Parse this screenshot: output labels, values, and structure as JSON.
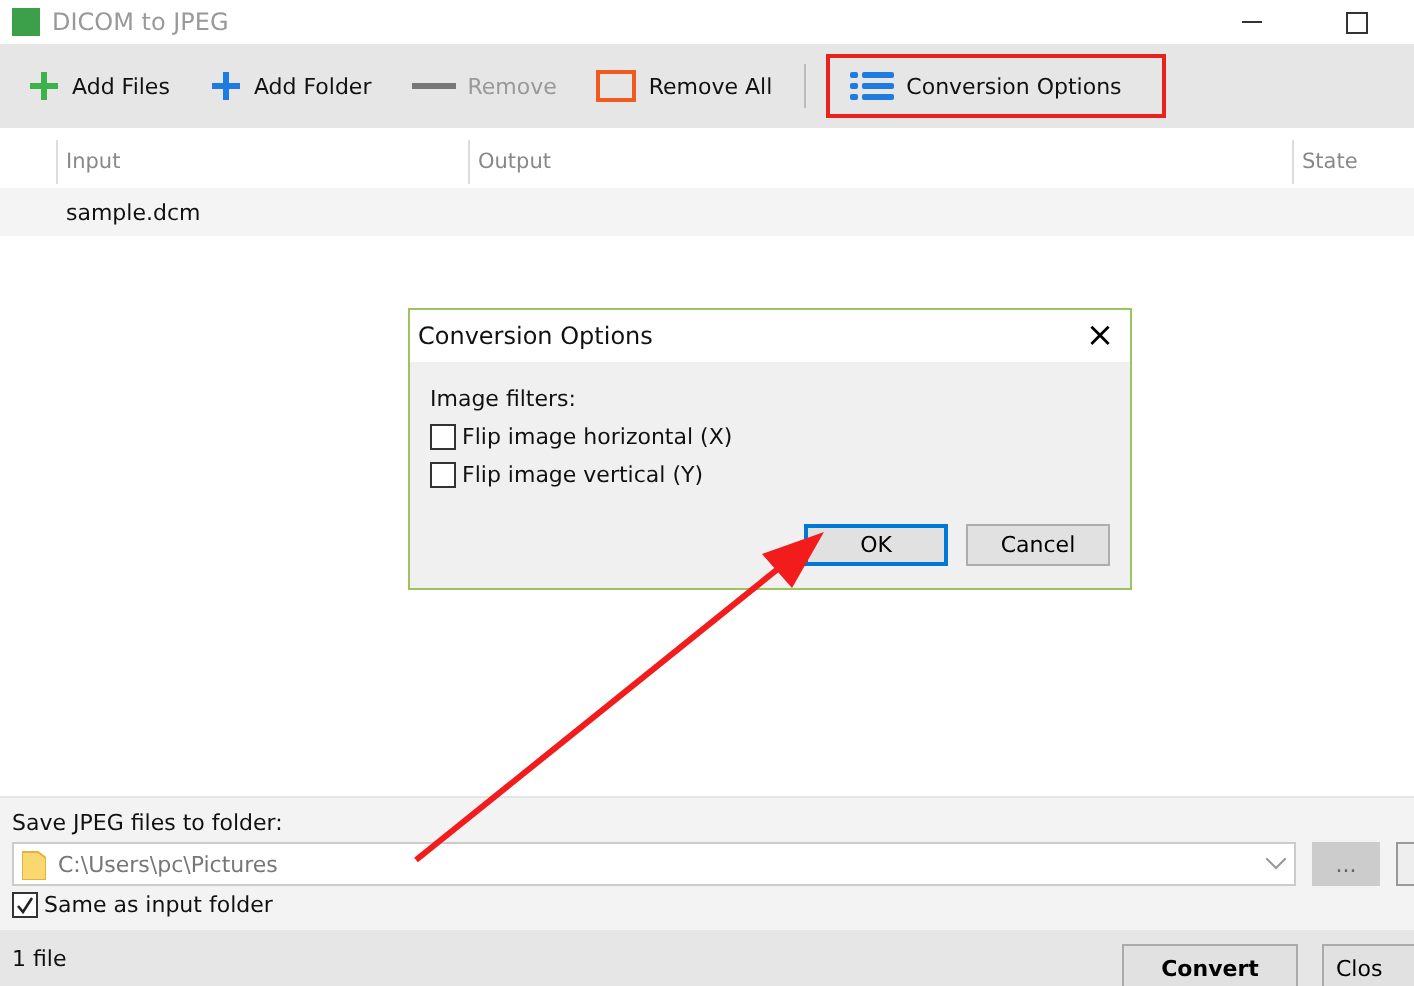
{
  "window": {
    "title": "DICOM to JPEG"
  },
  "toolbar": [
    {
      "label": "Add Files",
      "kind": "add",
      "disabled": false
    },
    {
      "label": "Add Folder",
      "kind": "folder",
      "disabled": false
    },
    {
      "label": "Remove",
      "kind": "remove",
      "disabled": true
    },
    {
      "label": "Remove All",
      "kind": "clear",
      "disabled": false
    },
    {
      "label": "Conversion Options",
      "kind": "options",
      "disabled": false,
      "highlighted": true
    }
  ],
  "table": {
    "columns": [
      "Input",
      "Output",
      "State"
    ],
    "rows": [
      {
        "input": "sample.dcm"
      }
    ]
  },
  "output": {
    "label": "Save JPEG files to folder:",
    "path": "C:\\Users\\pc\\Pictures",
    "browse": "...",
    "same_as_input": {
      "label": "Same as input folder",
      "checked": true
    }
  },
  "status_bar": {
    "count": "1 file",
    "buttons": [
      "Convert",
      "Clos"
    ]
  },
  "dialog": {
    "title": "Conversion Options",
    "close": "×",
    "group_label": "Image filters:",
    "options": [
      {
        "label": "Flip image horizontal (X)",
        "checked": false
      },
      {
        "label": "Flip image vertical (Y)",
        "checked": false
      }
    ],
    "buttons": [
      {
        "label": "OK",
        "selected": true
      },
      {
        "label": "Cancel",
        "selected": false
      }
    ]
  }
}
